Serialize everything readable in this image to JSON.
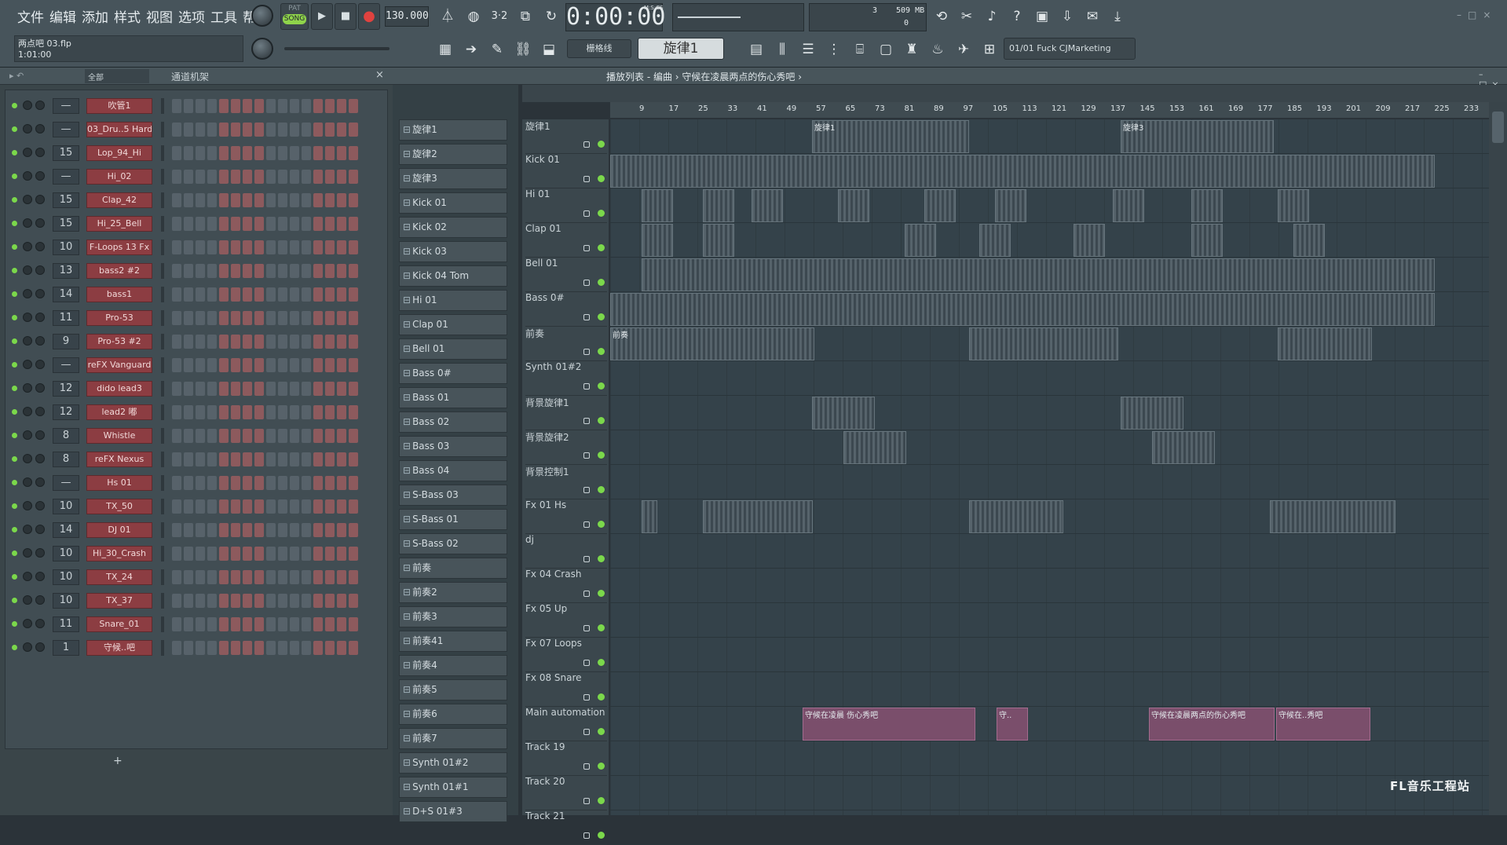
{
  "menu": [
    "文件",
    "编辑",
    "添加",
    "样式",
    "视图",
    "选项",
    "工具",
    "帮助"
  ],
  "project": {
    "file": "两点吧 03.flp",
    "time": "1:01:00"
  },
  "transport": {
    "mode_pat": "PAT",
    "mode_song": "SONG",
    "tempo": "130.000",
    "clock": "0:00:00",
    "clock_unit": "M:S:CS",
    "mem": "509 MB",
    "cpu_a": "3",
    "cpu_b": "0"
  },
  "pattern_select": "旋律1",
  "snap": "栅格线",
  "news": "01/01  Fuck CJMarketing",
  "rack": {
    "filter": "全部",
    "title": "通道机架",
    "add": "+"
  },
  "channels": [
    {
      "num": "—",
      "name": "吹管1"
    },
    {
      "num": "—",
      "name": "03_Dru..5 Hard"
    },
    {
      "num": "15",
      "name": "Lop_94_Hi"
    },
    {
      "num": "—",
      "name": "Hi_02"
    },
    {
      "num": "15",
      "name": "Clap_42"
    },
    {
      "num": "15",
      "name": "Hi_25_Bell"
    },
    {
      "num": "10",
      "name": "F-Loops 13 Fx"
    },
    {
      "num": "13",
      "name": "bass2 #2"
    },
    {
      "num": "14",
      "name": "bass1"
    },
    {
      "num": "11",
      "name": "Pro-53"
    },
    {
      "num": "9",
      "name": "Pro-53 #2"
    },
    {
      "num": "—",
      "name": "reFX Vanguard"
    },
    {
      "num": "12",
      "name": "dido lead3"
    },
    {
      "num": "12",
      "name": "lead2 嘟"
    },
    {
      "num": "8",
      "name": "Whistle"
    },
    {
      "num": "8",
      "name": "reFX Nexus"
    },
    {
      "num": "—",
      "name": "Hs 01"
    },
    {
      "num": "10",
      "name": "TX_50"
    },
    {
      "num": "14",
      "name": "DJ 01"
    },
    {
      "num": "10",
      "name": "Hi_30_Crash"
    },
    {
      "num": "10",
      "name": "TX_24"
    },
    {
      "num": "10",
      "name": "TX_37"
    },
    {
      "num": "11",
      "name": "Snare_01"
    },
    {
      "num": "1",
      "name": "守候..吧"
    }
  ],
  "playlist": {
    "title": "播放列表 - 编曲 › 守候在凌晨两点的伤心秀吧 ›"
  },
  "patterns": [
    "旋律1",
    "旋律2",
    "旋律3",
    "Kick 01",
    "Kick 02",
    "Kick 03",
    "Kick 04 Tom",
    "Hi 01",
    "Clap 01",
    "Bell 01",
    "Bass 0#",
    "Bass 01",
    "Bass 02",
    "Bass 03",
    "Bass 04",
    "S-Bass 03",
    "S-Bass 01",
    "S-Bass 02",
    "前奏",
    "前奏2",
    "前奏3",
    "前奏41",
    "前奏4",
    "前奏5",
    "前奏6",
    "前奏7",
    "Synth 01#2",
    "Synth 01#1",
    "D+S 01#3"
  ],
  "tracks": [
    "旋律1",
    "Kick 01",
    "Hi 01",
    "Clap 01",
    "Bell 01",
    "Bass 0#",
    "前奏",
    "Synth 01#2",
    "背景旋律1",
    "背景旋律2",
    "背景控制1",
    "Fx 01 Hs",
    "dj",
    "Fx 04 Crash",
    "Fx 05 Up",
    "Fx 07 Loops",
    "Fx 08 Snare",
    "Main automation",
    "Track 19",
    "Track 20",
    "Track 21"
  ],
  "ruler": [
    "9",
    "17",
    "25",
    "33",
    "41",
    "49",
    "57",
    "65",
    "73",
    "81",
    "89",
    "97",
    "105",
    "113",
    "121",
    "129",
    "137",
    "145",
    "153",
    "161",
    "169",
    "177",
    "185",
    "193",
    "201",
    "209",
    "217",
    "225",
    "233"
  ],
  "clips": {
    "melody": "旋律1",
    "melody3": "旋律3",
    "intro": "前奏",
    "audio1": "守候在凌晨 伤心秀吧",
    "audio2": "守候在..秀吧",
    "audio3": "守候在凌晨两点的伤心秀吧",
    "audio4": "守..",
    "audio5": "守候在..秀吧"
  },
  "watermark": "FL音乐工程站",
  "colors": {
    "accent": "#7bd84b",
    "channel": "#8c3d42",
    "audio": "#7a4e6b",
    "record": "#e0423f"
  }
}
